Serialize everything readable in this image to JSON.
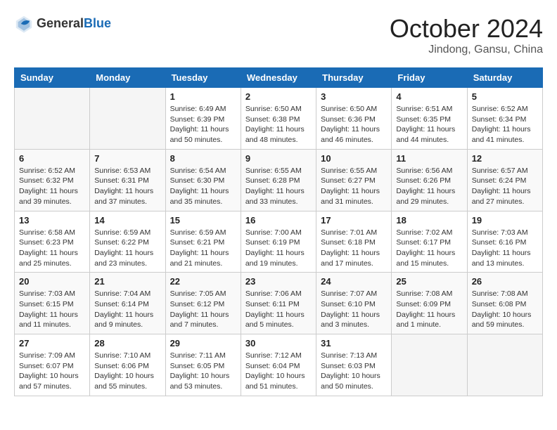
{
  "header": {
    "logo_general": "General",
    "logo_blue": "Blue",
    "month": "October 2024",
    "location": "Jindong, Gansu, China"
  },
  "days_of_week": [
    "Sunday",
    "Monday",
    "Tuesday",
    "Wednesday",
    "Thursday",
    "Friday",
    "Saturday"
  ],
  "weeks": [
    [
      {
        "day": "",
        "sunrise": "",
        "sunset": "",
        "daylight": ""
      },
      {
        "day": "",
        "sunrise": "",
        "sunset": "",
        "daylight": ""
      },
      {
        "day": "1",
        "sunrise": "Sunrise: 6:49 AM",
        "sunset": "Sunset: 6:39 PM",
        "daylight": "Daylight: 11 hours and 50 minutes."
      },
      {
        "day": "2",
        "sunrise": "Sunrise: 6:50 AM",
        "sunset": "Sunset: 6:38 PM",
        "daylight": "Daylight: 11 hours and 48 minutes."
      },
      {
        "day": "3",
        "sunrise": "Sunrise: 6:50 AM",
        "sunset": "Sunset: 6:36 PM",
        "daylight": "Daylight: 11 hours and 46 minutes."
      },
      {
        "day": "4",
        "sunrise": "Sunrise: 6:51 AM",
        "sunset": "Sunset: 6:35 PM",
        "daylight": "Daylight: 11 hours and 44 minutes."
      },
      {
        "day": "5",
        "sunrise": "Sunrise: 6:52 AM",
        "sunset": "Sunset: 6:34 PM",
        "daylight": "Daylight: 11 hours and 41 minutes."
      }
    ],
    [
      {
        "day": "6",
        "sunrise": "Sunrise: 6:52 AM",
        "sunset": "Sunset: 6:32 PM",
        "daylight": "Daylight: 11 hours and 39 minutes."
      },
      {
        "day": "7",
        "sunrise": "Sunrise: 6:53 AM",
        "sunset": "Sunset: 6:31 PM",
        "daylight": "Daylight: 11 hours and 37 minutes."
      },
      {
        "day": "8",
        "sunrise": "Sunrise: 6:54 AM",
        "sunset": "Sunset: 6:30 PM",
        "daylight": "Daylight: 11 hours and 35 minutes."
      },
      {
        "day": "9",
        "sunrise": "Sunrise: 6:55 AM",
        "sunset": "Sunset: 6:28 PM",
        "daylight": "Daylight: 11 hours and 33 minutes."
      },
      {
        "day": "10",
        "sunrise": "Sunrise: 6:55 AM",
        "sunset": "Sunset: 6:27 PM",
        "daylight": "Daylight: 11 hours and 31 minutes."
      },
      {
        "day": "11",
        "sunrise": "Sunrise: 6:56 AM",
        "sunset": "Sunset: 6:26 PM",
        "daylight": "Daylight: 11 hours and 29 minutes."
      },
      {
        "day": "12",
        "sunrise": "Sunrise: 6:57 AM",
        "sunset": "Sunset: 6:24 PM",
        "daylight": "Daylight: 11 hours and 27 minutes."
      }
    ],
    [
      {
        "day": "13",
        "sunrise": "Sunrise: 6:58 AM",
        "sunset": "Sunset: 6:23 PM",
        "daylight": "Daylight: 11 hours and 25 minutes."
      },
      {
        "day": "14",
        "sunrise": "Sunrise: 6:59 AM",
        "sunset": "Sunset: 6:22 PM",
        "daylight": "Daylight: 11 hours and 23 minutes."
      },
      {
        "day": "15",
        "sunrise": "Sunrise: 6:59 AM",
        "sunset": "Sunset: 6:21 PM",
        "daylight": "Daylight: 11 hours and 21 minutes."
      },
      {
        "day": "16",
        "sunrise": "Sunrise: 7:00 AM",
        "sunset": "Sunset: 6:19 PM",
        "daylight": "Daylight: 11 hours and 19 minutes."
      },
      {
        "day": "17",
        "sunrise": "Sunrise: 7:01 AM",
        "sunset": "Sunset: 6:18 PM",
        "daylight": "Daylight: 11 hours and 17 minutes."
      },
      {
        "day": "18",
        "sunrise": "Sunrise: 7:02 AM",
        "sunset": "Sunset: 6:17 PM",
        "daylight": "Daylight: 11 hours and 15 minutes."
      },
      {
        "day": "19",
        "sunrise": "Sunrise: 7:03 AM",
        "sunset": "Sunset: 6:16 PM",
        "daylight": "Daylight: 11 hours and 13 minutes."
      }
    ],
    [
      {
        "day": "20",
        "sunrise": "Sunrise: 7:03 AM",
        "sunset": "Sunset: 6:15 PM",
        "daylight": "Daylight: 11 hours and 11 minutes."
      },
      {
        "day": "21",
        "sunrise": "Sunrise: 7:04 AM",
        "sunset": "Sunset: 6:14 PM",
        "daylight": "Daylight: 11 hours and 9 minutes."
      },
      {
        "day": "22",
        "sunrise": "Sunrise: 7:05 AM",
        "sunset": "Sunset: 6:12 PM",
        "daylight": "Daylight: 11 hours and 7 minutes."
      },
      {
        "day": "23",
        "sunrise": "Sunrise: 7:06 AM",
        "sunset": "Sunset: 6:11 PM",
        "daylight": "Daylight: 11 hours and 5 minutes."
      },
      {
        "day": "24",
        "sunrise": "Sunrise: 7:07 AM",
        "sunset": "Sunset: 6:10 PM",
        "daylight": "Daylight: 11 hours and 3 minutes."
      },
      {
        "day": "25",
        "sunrise": "Sunrise: 7:08 AM",
        "sunset": "Sunset: 6:09 PM",
        "daylight": "Daylight: 11 hours and 1 minute."
      },
      {
        "day": "26",
        "sunrise": "Sunrise: 7:08 AM",
        "sunset": "Sunset: 6:08 PM",
        "daylight": "Daylight: 10 hours and 59 minutes."
      }
    ],
    [
      {
        "day": "27",
        "sunrise": "Sunrise: 7:09 AM",
        "sunset": "Sunset: 6:07 PM",
        "daylight": "Daylight: 10 hours and 57 minutes."
      },
      {
        "day": "28",
        "sunrise": "Sunrise: 7:10 AM",
        "sunset": "Sunset: 6:06 PM",
        "daylight": "Daylight: 10 hours and 55 minutes."
      },
      {
        "day": "29",
        "sunrise": "Sunrise: 7:11 AM",
        "sunset": "Sunset: 6:05 PM",
        "daylight": "Daylight: 10 hours and 53 minutes."
      },
      {
        "day": "30",
        "sunrise": "Sunrise: 7:12 AM",
        "sunset": "Sunset: 6:04 PM",
        "daylight": "Daylight: 10 hours and 51 minutes."
      },
      {
        "day": "31",
        "sunrise": "Sunrise: 7:13 AM",
        "sunset": "Sunset: 6:03 PM",
        "daylight": "Daylight: 10 hours and 50 minutes."
      },
      {
        "day": "",
        "sunrise": "",
        "sunset": "",
        "daylight": ""
      },
      {
        "day": "",
        "sunrise": "",
        "sunset": "",
        "daylight": ""
      }
    ]
  ]
}
